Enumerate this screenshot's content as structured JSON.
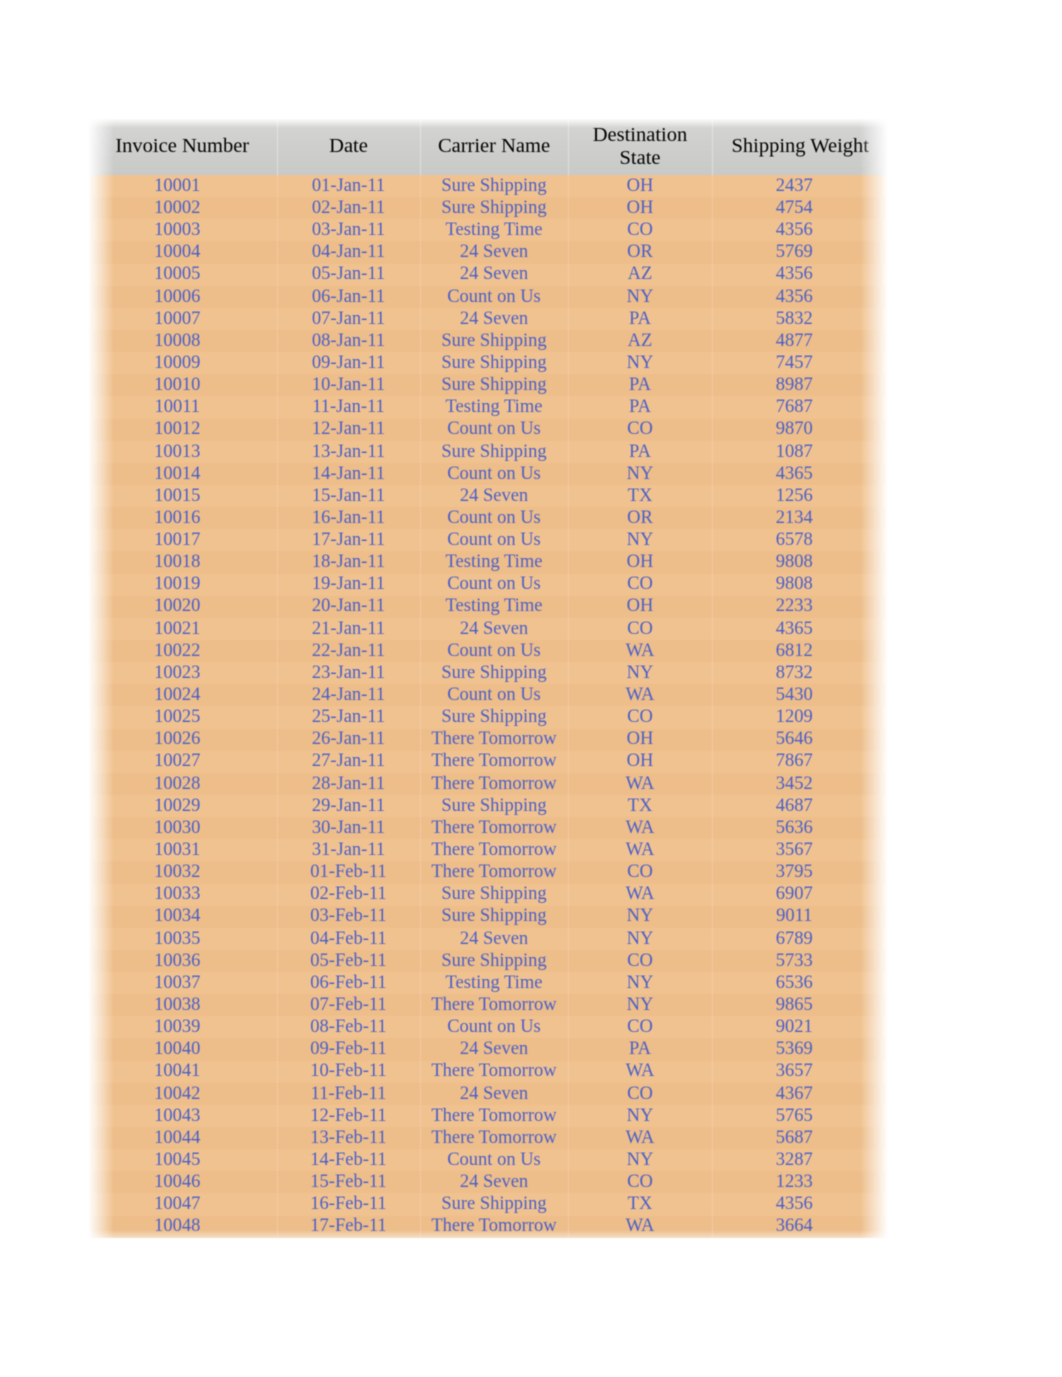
{
  "table": {
    "columns": [
      {
        "key": "invoice_number",
        "label": "Invoice Number",
        "align": "center"
      },
      {
        "key": "date",
        "label": "Date",
        "align": "center"
      },
      {
        "key": "carrier_name",
        "label": "Carrier Name",
        "align": "center"
      },
      {
        "key": "destination_state",
        "label": "Destination State",
        "align": "center"
      },
      {
        "key": "shipping_weight",
        "label": "Shipping Weight",
        "align": "center"
      }
    ],
    "colors": {
      "header_background": "#cfcfcd",
      "header_text": "#000000",
      "row_background": "#f0c08c",
      "row_text": "#4a5fc8",
      "page_background": "#ffffff"
    },
    "row_count": 48,
    "rows": [
      [
        "10001",
        "01-Jan-11",
        "Sure Shipping",
        "OH",
        "2437"
      ],
      [
        "10002",
        "02-Jan-11",
        "Sure Shipping",
        "OH",
        "4754"
      ],
      [
        "10003",
        "03-Jan-11",
        "Testing Time",
        "CO",
        "4356"
      ],
      [
        "10004",
        "04-Jan-11",
        "24 Seven",
        "OR",
        "5769"
      ],
      [
        "10005",
        "05-Jan-11",
        "24 Seven",
        "AZ",
        "4356"
      ],
      [
        "10006",
        "06-Jan-11",
        "Count on Us",
        "NY",
        "4356"
      ],
      [
        "10007",
        "07-Jan-11",
        "24 Seven",
        "PA",
        "5832"
      ],
      [
        "10008",
        "08-Jan-11",
        "Sure Shipping",
        "AZ",
        "4877"
      ],
      [
        "10009",
        "09-Jan-11",
        "Sure Shipping",
        "NY",
        "7457"
      ],
      [
        "10010",
        "10-Jan-11",
        "Sure Shipping",
        "PA",
        "8987"
      ],
      [
        "10011",
        "11-Jan-11",
        "Testing Time",
        "PA",
        "7687"
      ],
      [
        "10012",
        "12-Jan-11",
        "Count on Us",
        "CO",
        "9870"
      ],
      [
        "10013",
        "13-Jan-11",
        "Sure Shipping",
        "PA",
        "1087"
      ],
      [
        "10014",
        "14-Jan-11",
        "Count on Us",
        "NY",
        "4365"
      ],
      [
        "10015",
        "15-Jan-11",
        "24 Seven",
        "TX",
        "1256"
      ],
      [
        "10016",
        "16-Jan-11",
        "Count on Us",
        "OR",
        "2134"
      ],
      [
        "10017",
        "17-Jan-11",
        "Count on Us",
        "NY",
        "6578"
      ],
      [
        "10018",
        "18-Jan-11",
        "Testing Time",
        "OH",
        "9808"
      ],
      [
        "10019",
        "19-Jan-11",
        "Count on Us",
        "CO",
        "9808"
      ],
      [
        "10020",
        "20-Jan-11",
        "Testing Time",
        "OH",
        "2233"
      ],
      [
        "10021",
        "21-Jan-11",
        "24 Seven",
        "CO",
        "4365"
      ],
      [
        "10022",
        "22-Jan-11",
        "Count on Us",
        "WA",
        "6812"
      ],
      [
        "10023",
        "23-Jan-11",
        "Sure Shipping",
        "NY",
        "8732"
      ],
      [
        "10024",
        "24-Jan-11",
        "Count on Us",
        "WA",
        "5430"
      ],
      [
        "10025",
        "25-Jan-11",
        "Sure Shipping",
        "CO",
        "1209"
      ],
      [
        "10026",
        "26-Jan-11",
        "There Tomorrow",
        "OH",
        "5646"
      ],
      [
        "10027",
        "27-Jan-11",
        "There Tomorrow",
        "OH",
        "7867"
      ],
      [
        "10028",
        "28-Jan-11",
        "There Tomorrow",
        "WA",
        "3452"
      ],
      [
        "10029",
        "29-Jan-11",
        "Sure Shipping",
        "TX",
        "4687"
      ],
      [
        "10030",
        "30-Jan-11",
        "There Tomorrow",
        "WA",
        "5636"
      ],
      [
        "10031",
        "31-Jan-11",
        "There Tomorrow",
        "WA",
        "3567"
      ],
      [
        "10032",
        "01-Feb-11",
        "There Tomorrow",
        "CO",
        "3795"
      ],
      [
        "10033",
        "02-Feb-11",
        "Sure Shipping",
        "WA",
        "6907"
      ],
      [
        "10034",
        "03-Feb-11",
        "Sure Shipping",
        "NY",
        "9011"
      ],
      [
        "10035",
        "04-Feb-11",
        "24 Seven",
        "NY",
        "6789"
      ],
      [
        "10036",
        "05-Feb-11",
        "Sure Shipping",
        "CO",
        "5733"
      ],
      [
        "10037",
        "06-Feb-11",
        "Testing Time",
        "NY",
        "6536"
      ],
      [
        "10038",
        "07-Feb-11",
        "There Tomorrow",
        "NY",
        "9865"
      ],
      [
        "10039",
        "08-Feb-11",
        "Count on Us",
        "CO",
        "9021"
      ],
      [
        "10040",
        "09-Feb-11",
        "24 Seven",
        "PA",
        "5369"
      ],
      [
        "10041",
        "10-Feb-11",
        "There Tomorrow",
        "WA",
        "3657"
      ],
      [
        "10042",
        "11-Feb-11",
        "24 Seven",
        "CO",
        "4367"
      ],
      [
        "10043",
        "12-Feb-11",
        "There Tomorrow",
        "NY",
        "5765"
      ],
      [
        "10044",
        "13-Feb-11",
        "There Tomorrow",
        "WA",
        "5687"
      ],
      [
        "10045",
        "14-Feb-11",
        "Count on Us",
        "NY",
        "3287"
      ],
      [
        "10046",
        "15-Feb-11",
        "24 Seven",
        "CO",
        "1233"
      ],
      [
        "10047",
        "16-Feb-11",
        "Sure Shipping",
        "TX",
        "4356"
      ],
      [
        "10048",
        "17-Feb-11",
        "There Tomorrow",
        "WA",
        "3664"
      ]
    ]
  }
}
